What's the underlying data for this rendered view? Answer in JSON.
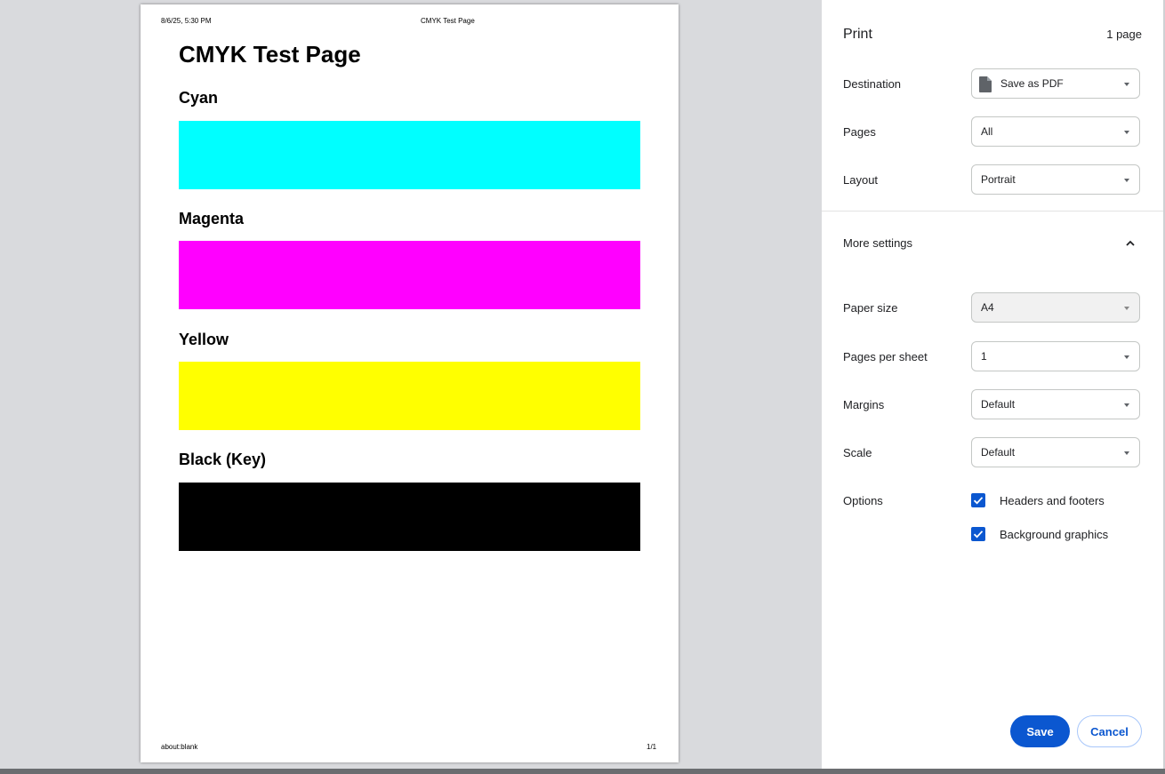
{
  "preview": {
    "header_date": "8/6/25, 5:30 PM",
    "header_title": "CMYK Test Page",
    "footer_url": "about:blank",
    "footer_page": "1/1",
    "doc_title": "CMYK Test Page",
    "swatches": [
      {
        "label": "Cyan",
        "color": "#00ffff"
      },
      {
        "label": "Magenta",
        "color": "#ff00ff"
      },
      {
        "label": "Yellow",
        "color": "#ffff00"
      },
      {
        "label": "Black (Key)",
        "color": "#000000"
      }
    ]
  },
  "panel": {
    "title": "Print",
    "page_count": "1 page",
    "destination": {
      "label": "Destination",
      "value": "Save as PDF",
      "icon": "file-icon"
    },
    "pages": {
      "label": "Pages",
      "value": "All"
    },
    "layout": {
      "label": "Layout",
      "value": "Portrait"
    },
    "more_settings": {
      "label": "More settings",
      "expanded": true,
      "icon": "chevron-up-icon"
    },
    "paper_size": {
      "label": "Paper size",
      "value": "A4",
      "disabled": true
    },
    "pages_per_sheet": {
      "label": "Pages per sheet",
      "value": "1"
    },
    "margins": {
      "label": "Margins",
      "value": "Default"
    },
    "scale": {
      "label": "Scale",
      "value": "Default"
    },
    "options": {
      "label": "Options",
      "headers_footers": {
        "label": "Headers and footers",
        "checked": true
      },
      "background_graphics": {
        "label": "Background graphics",
        "checked": true
      }
    },
    "save_label": "Save",
    "cancel_label": "Cancel",
    "accent_color": "#0b57d0"
  }
}
